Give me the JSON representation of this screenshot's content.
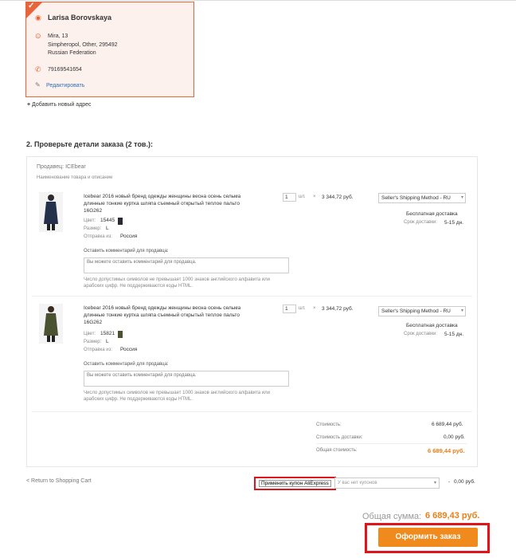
{
  "address": {
    "name": "Larisa Borovskaya",
    "street": "Mira, 13",
    "city_line": "Simpheropol, Other, 295492",
    "country": "Russian Federation",
    "phone": "79169541654",
    "edit_label": "Редактировать",
    "add_new_label": "Добавить новый адрес"
  },
  "section_title": "2. Проверьте детали заказа (2 тов.):",
  "order": {
    "seller_label": "Продавец: ICEbear",
    "column_header": "Наименование товара и описание",
    "items": [
      {
        "title": "Icebear 2016 новый бренд одежды женщины весна осень сельма длинные тонкие куртка шляпа съемный открытый теплое пальто 16G262",
        "color_label": "Цвет:",
        "color_value": "15445",
        "size_label": "Размер:",
        "size_value": "L",
        "ship_from_label": "Отправка из:",
        "ship_from_value": "Россия",
        "qty": "1",
        "unit": "шт.",
        "times": "×",
        "unit_price": "3 344,72 руб.",
        "shipping_method": "Seller's Shipping Method - RU",
        "free_shipping": "Бесплатная доставка",
        "delivery_label": "Срок доставки:",
        "delivery_value": "5-15 дн.",
        "comment_label": "Оставить комментарий для продавца:",
        "comment_placeholder": "Вы можете оставить комментарий для продавца.",
        "hint": "Число допустимых символов не превышает 1000 знаков английского алфавита или арабских цифр. Не поддерживаются коды HTML."
      },
      {
        "title": "Icebear 2016 новый бренд одежды женщины весна осень сельма длинные тонкие куртка шляпа съемный открытый теплое пальто 16G262",
        "color_label": "Цвет:",
        "color_value": "15821",
        "size_label": "Размер:",
        "size_value": "L",
        "ship_from_label": "Отправка из:",
        "ship_from_value": "Россия",
        "qty": "1",
        "unit": "шт.",
        "times": "×",
        "unit_price": "3 344,72 руб.",
        "shipping_method": "Seller's Shipping Method - RU",
        "free_shipping": "Бесплатная доставка",
        "delivery_label": "Срок доставки:",
        "delivery_value": "5-15 дн.",
        "comment_label": "Оставить комментарий для продавца:",
        "comment_placeholder": "Вы можете оставить комментарий для продавца.",
        "hint": "Число допустимых символов не превышает 1000 знаков английского алфавита или арабских цифр. Не поддерживаются коды HTML."
      }
    ],
    "summary": {
      "cost_label": "Стоимость:",
      "cost_value": "6 689,44 руб.",
      "shipping_label": "Стоимость доставки:",
      "shipping_value": "0,00 руб.",
      "total_label": "Общая стоимость:",
      "total_value": "6 689,44 руб."
    }
  },
  "footer": {
    "back_link": "< Return to Shopping Cart",
    "coupon_button": "Применить купон AliExpress",
    "coupon_select_placeholder": "У вас нет купонов",
    "coupon_dash": "-",
    "coupon_amount": "0,00 руб.",
    "grand_total_label": "Общая сумма:",
    "grand_total_value": "6 689,43 руб.",
    "submit_label": "Оформить заказ"
  },
  "colors": {
    "accent_orange": "#f08a1d",
    "highlight_red": "#e0141b",
    "card_border": "#e8643a"
  }
}
